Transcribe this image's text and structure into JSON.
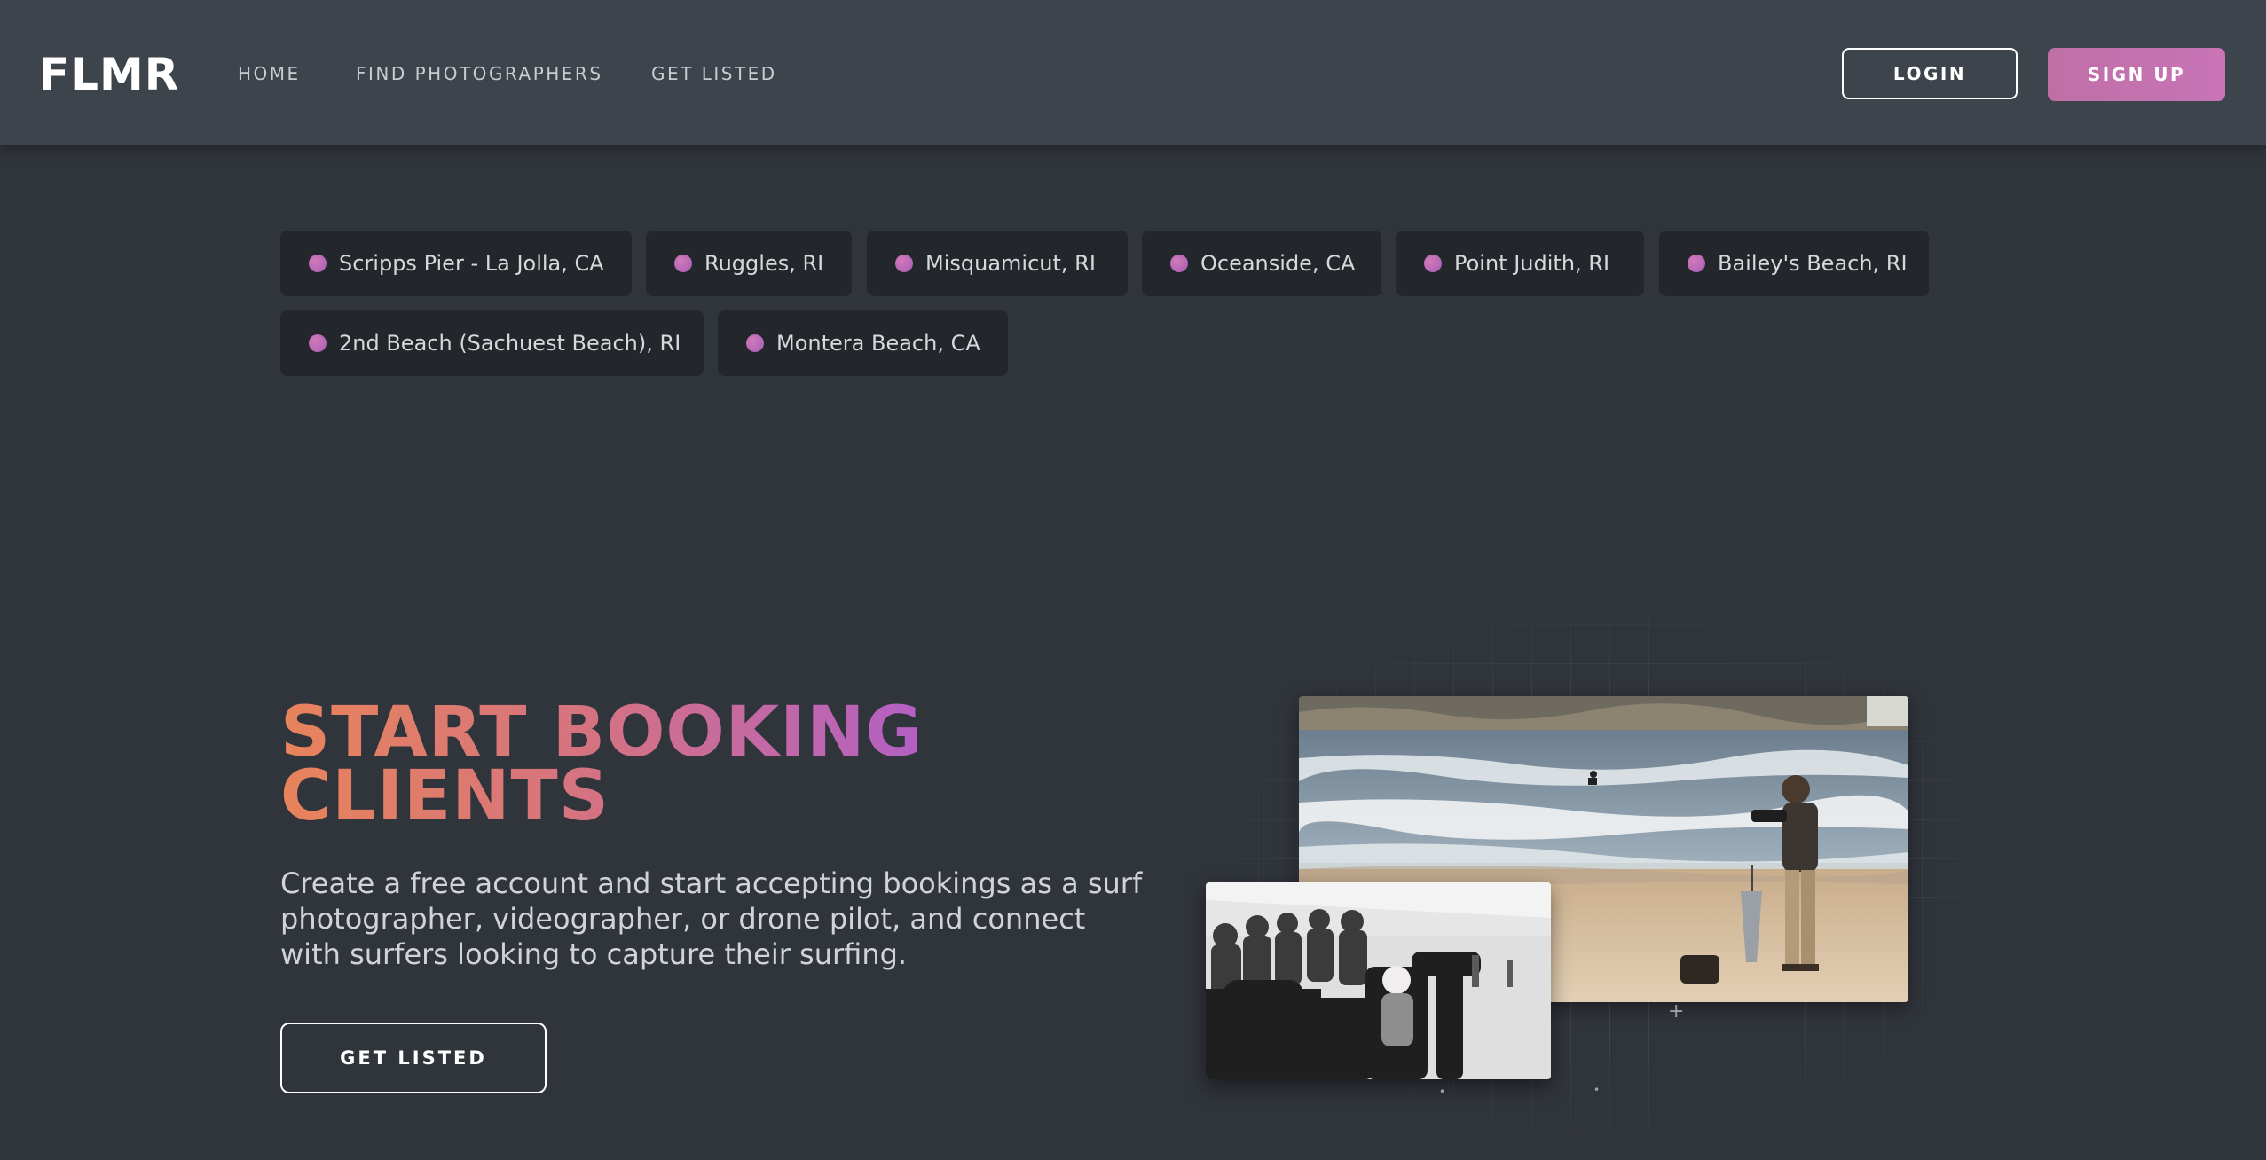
{
  "nav": {
    "logo": "FLMR",
    "links": [
      "HOME",
      "FIND PHOTOGRAPHERS",
      "GET LISTED"
    ],
    "login_label": "LOGIN",
    "signup_label": "SIGN UP"
  },
  "locations": [
    "Scripps Pier - La Jolla, CA",
    "Ruggles, RI",
    "Misquamicut, RI",
    "Oceanside, CA",
    "Point Judith, RI",
    "Bailey's Beach, RI",
    "2nd Beach (Sachuest Beach), RI",
    "Montera Beach, CA"
  ],
  "hero": {
    "title_line1": "START BOOKING",
    "title_line2": "CLIENTS",
    "description": "Create a free account and start accepting bookings as a surf photographer, videographer, or drone pilot, and connect with surfers looking to capture their surfing.",
    "cta_label": "GET LISTED"
  },
  "colors": {
    "background": "#30343b",
    "navbar": "#3e444b",
    "tag_bg": "#23262b",
    "accent_pink": "#c874b6",
    "gradient_start": "#e8845a",
    "gradient_end": "#b360c4"
  },
  "icons": {
    "location_dot": "pink-dot-icon"
  }
}
